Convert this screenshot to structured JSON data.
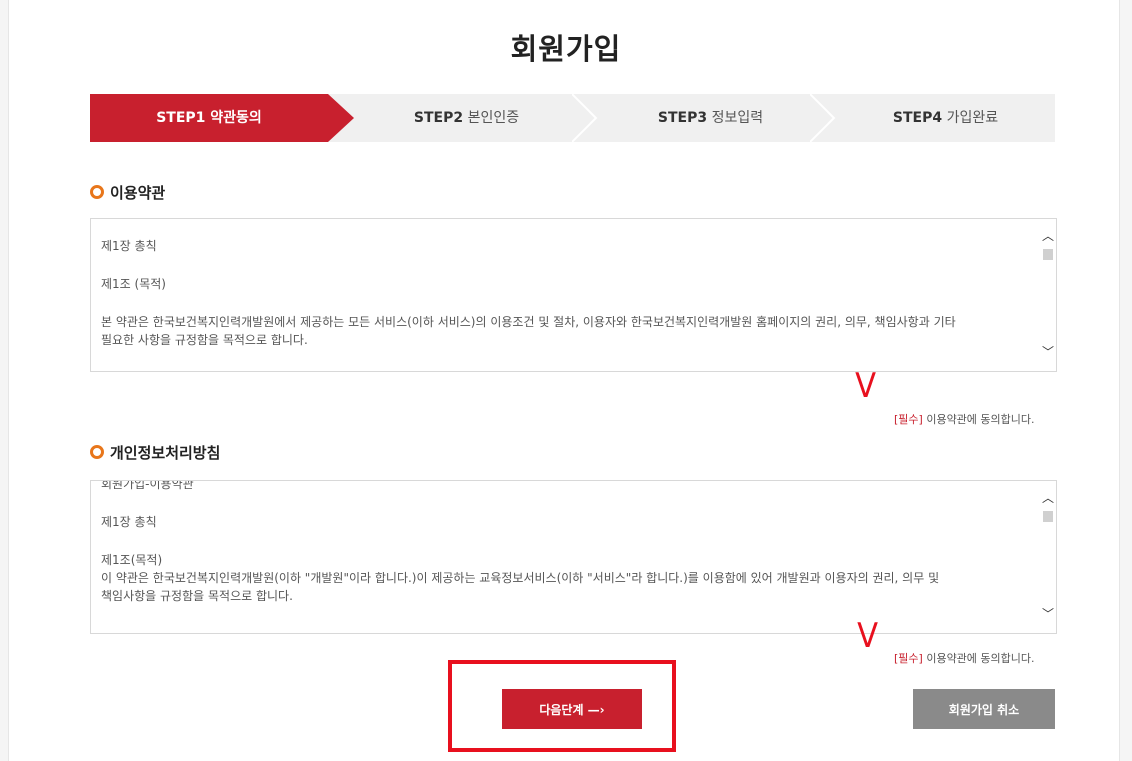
{
  "page": {
    "title": "회원가입"
  },
  "steps": [
    {
      "num": "STEP1",
      "label": "약관동의"
    },
    {
      "num": "STEP2",
      "label": "본인인증"
    },
    {
      "num": "STEP3",
      "label": "정보입력"
    },
    {
      "num": "STEP4",
      "label": "가입완료"
    }
  ],
  "terms": {
    "title": "이용약관",
    "lines": [
      "제1장 총칙",
      "제1조 (목적)",
      "본 약관은 한국보건복지인력개발원에서 제공하는 모든 서비스(이하 서비스)의 이용조건 및 절차, 이용자와 한국보건복지인력개발원 홈페이지의 권리, 의무, 책임사항과 기타",
      "필요한 사항을 규정함을 목적으로 합니다."
    ],
    "agree_required": "[필수]",
    "agree_text": " 이용약관에 동의합니다."
  },
  "privacy": {
    "title": "개인정보처리방침",
    "lines": [
      "회원가입-이용약관",
      "제1장 총칙",
      "제1조(목적)",
      "이 약관은 한국보건복지인력개발원(이하 \"개발원\"이라 합니다.)이 제공하는 교육정보서비스(이하 \"서비스\"라 합니다.)를 이용함에 있어 개발원과 이용자의 권리, 의무 및",
      "책임사항을 규정함을 목적으로 합니다."
    ],
    "agree_required": "[필수]",
    "agree_text": " 이용약관에 동의합니다."
  },
  "annotations": {
    "check_mark": "V"
  },
  "buttons": {
    "next": "다음단계 —›",
    "cancel": "회원가입 취소"
  },
  "colors": {
    "accent": "#c8202e",
    "bullet": "#e8761b",
    "annotation": "#e8101e",
    "cancel": "#8a8a8a"
  }
}
